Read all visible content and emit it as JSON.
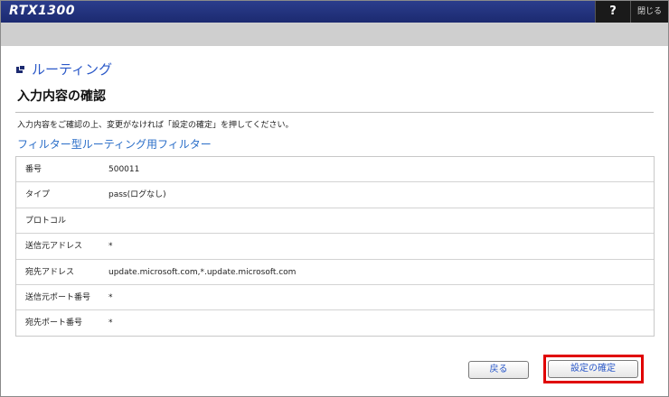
{
  "header": {
    "logo": "RTX1300",
    "help_label": "?",
    "close_label": "閉じる"
  },
  "section": {
    "title": "ルーティング"
  },
  "page": {
    "title": "入力内容の確認",
    "instruction": "入力内容をご確認の上、変更がなければ「設定の確定」を押してください。",
    "subtitle": "フィルター型ルーティング用フィルター"
  },
  "table": {
    "rows": [
      {
        "label": "番号",
        "value": "500011"
      },
      {
        "label": "タイプ",
        "value": "pass(ログなし)"
      },
      {
        "label": "プロトコル",
        "value": ""
      },
      {
        "label": "送信元アドレス",
        "value": "*"
      },
      {
        "label": "宛先アドレス",
        "value": "update.microsoft.com,*.update.microsoft.com"
      },
      {
        "label": "送信元ポート番号",
        "value": "*"
      },
      {
        "label": "宛先ポート番号",
        "value": "*"
      }
    ]
  },
  "buttons": {
    "back_label": "戻る",
    "confirm_label": "設定の確定"
  },
  "colors": {
    "header_bg": "#1c2a70",
    "accent_blue": "#2a58c8",
    "highlight_red": "#e00000"
  }
}
